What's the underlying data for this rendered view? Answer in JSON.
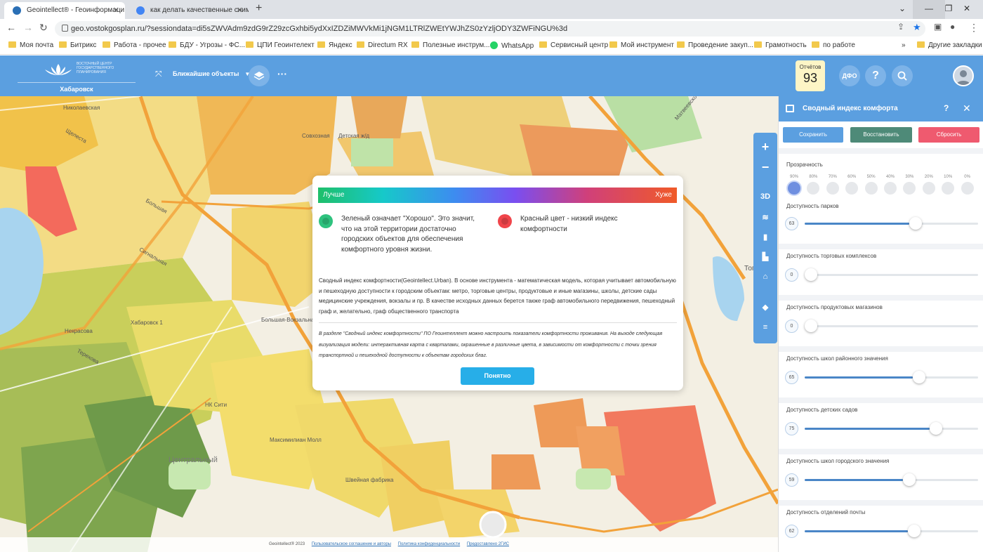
{
  "browser": {
    "tabs": [
      {
        "title": "Geointellect® - Геоинформаци",
        "active": true,
        "favicon_color": "#2a6fb5"
      },
      {
        "title": "как делать качественные сним",
        "active": false,
        "favicon_color": "#4285f4"
      }
    ],
    "url": "geo.vostokgosplan.ru/?sessiondata=di5sZWVAdm9zdG9rZ29zcGxhbi5ydXxIZDZiMWVkMi1jNGM1LTRlZWEtYWJhZS0zYzljODY3ZWFiNGU%3d",
    "bookmarks": [
      {
        "label": "Моя почта",
        "icon": "folder"
      },
      {
        "label": "Битрикс",
        "icon": "folder"
      },
      {
        "label": "Работа - прочее",
        "icon": "folder"
      },
      {
        "label": "БДУ - Угрозы - ФС...",
        "icon": "folder"
      },
      {
        "label": "ЦПИ Геоинтелект",
        "icon": "folder"
      },
      {
        "label": "Яндекс",
        "icon": "folder"
      },
      {
        "label": "Directum RX",
        "icon": "folder"
      },
      {
        "label": "Полезные инструм...",
        "icon": "folder"
      },
      {
        "label": "WhatsApp",
        "icon": "whatsapp"
      },
      {
        "label": "Сервисный центр",
        "icon": "folder"
      },
      {
        "label": "Мой инструмент",
        "icon": "folder"
      },
      {
        "label": "Проведение закуп...",
        "icon": "folder"
      },
      {
        "label": "Грамотность",
        "icon": "folder"
      },
      {
        "label": "по работе",
        "icon": "folder"
      }
    ],
    "other_bookmarks": "Другие закладки"
  },
  "header": {
    "logo_text": "ВОСТОЧНЫЙ ЦЕНТР ГОСУДАРСТВЕННОГО ПЛАНИРОВАНИЯ",
    "city": "Хабаровск",
    "nearby_label": "Ближайшие объекты",
    "reports_label": "Отчётов",
    "reports_count": "93",
    "dfo_label": "ДФО",
    "help_label": "?"
  },
  "map": {
    "labels": [
      {
        "text": "Николаевская"
      },
      {
        "text": "Щелеста"
      },
      {
        "text": "Совхозная"
      },
      {
        "text": "Детская ж/д"
      },
      {
        "text": "Большая"
      },
      {
        "text": "Сигнальная"
      },
      {
        "text": "Хабаровск 1"
      },
      {
        "text": "Некрасова"
      },
      {
        "text": "Терехова"
      },
      {
        "text": "Большая-Вокзальная"
      },
      {
        "text": "НК Сити"
      },
      {
        "text": "Максимилиан Молл"
      },
      {
        "text": "Центральный"
      },
      {
        "text": "Швейная фабрика"
      },
      {
        "text": "Тополев"
      },
      {
        "text": "Матвеевское"
      }
    ],
    "controls": [
      "+",
      "−",
      "3D"
    ]
  },
  "modal": {
    "better": "Лучше",
    "worse": "Хуже",
    "green_text": "Зеленый означает \"Хорошо\". Это значит, что на этой территории достаточно городских объектов для обеспечения комфортного уровня жизни.",
    "red_text": "Красный цвет - низкий индекс комфортности",
    "green_color": "#2ec27e",
    "red_color": "#f0454b",
    "description": "Сводный индекс комфортности(Geointellect.Urban). В основе инструмента - математическая модель, которая учитывает автомобильную и пешеходную доступности к городским объектам: метро, торговые центры, продуктовые и иные магазины, школы, детские сады медицинские учреждения, вокзалы и пр. В качестве исходных данных берется также граф автомобильного передвижения, пешеходный граф и, желательно, граф общественного транспорта",
    "note": "В разделе \"Сводный индекс комфортности\" ПО Геоинтеллект можно настроить показатели комфортности проживания. На выходе следующая визуализация модели: интерактивная карта с кварталами, окрашенные в различные цвета, в зависимости от комфортности с точки зрения транспортной и пешеходной доступности к объектам городских благ.",
    "ok": "Понятно"
  },
  "footer": {
    "copyright": "Geointellect® 2023",
    "links": [
      "Пользовательское соглашение и авторы",
      "Политика конфиденциальности",
      "Предоставлено 2ГИС"
    ]
  },
  "panel": {
    "title": "Сводный индекс комфорта",
    "help": "?",
    "buttons": [
      {
        "label": "Сохранить",
        "color": "#5b9fe0"
      },
      {
        "label": "Восстановить",
        "color": "#4e8a78"
      },
      {
        "label": "Сбросить",
        "color": "#ef5a6f"
      }
    ],
    "opacity_title": "Прозрачность",
    "opacity_levels": [
      "90%",
      "80%",
      "70%",
      "60%",
      "50%",
      "40%",
      "30%",
      "20%",
      "10%",
      "0%"
    ],
    "opacity_selected": 0,
    "partial_label": "Доступность парков",
    "partial_value": "63",
    "sliders": [
      {
        "label": "Доступность торговых комплексов",
        "value": "0",
        "fraction": 0.0
      },
      {
        "label": "Доступность продуктовых магазинов",
        "value": "0",
        "fraction": 0.0
      },
      {
        "label": "Доступность школ районного значения",
        "value": "65",
        "fraction": 0.65
      },
      {
        "label": "Доступность детских садов",
        "value": "75",
        "fraction": 0.75
      },
      {
        "label": "Доступность школ городского значения",
        "value": "59",
        "fraction": 0.59
      },
      {
        "label": "Доступность отделений почты",
        "value": "62",
        "fraction": 0.62
      }
    ],
    "park_fraction": 0.63
  }
}
